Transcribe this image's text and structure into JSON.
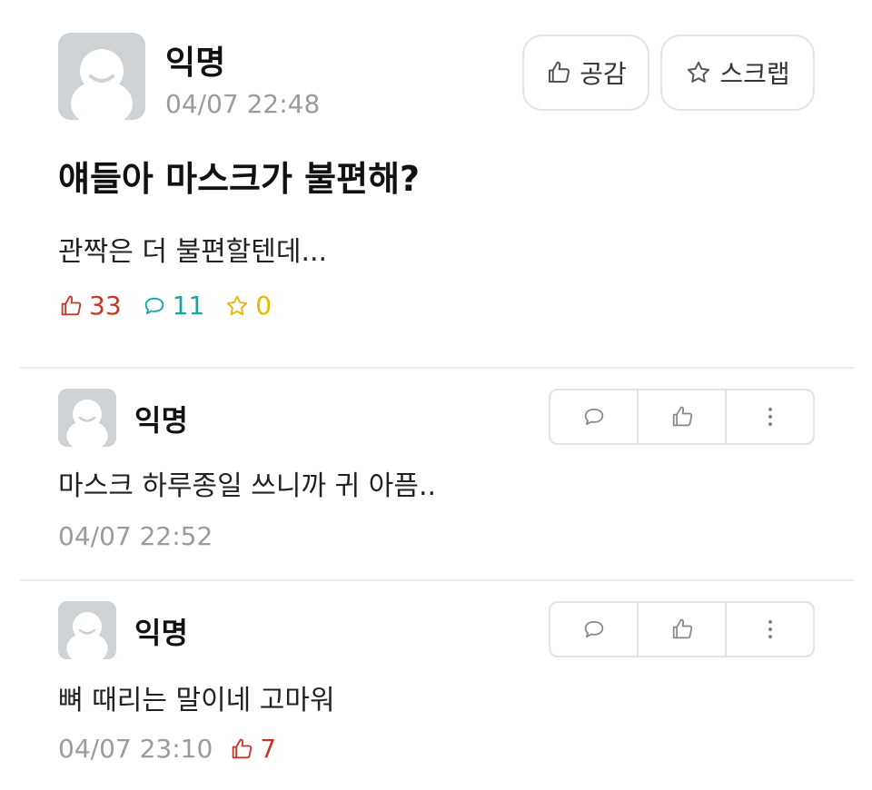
{
  "post": {
    "author": "익명",
    "time": "04/07 22:48",
    "like_button": "공감",
    "scrap_button": "스크랩",
    "title": "얘들아 마스크가 불편해?",
    "body": "관짝은 더 불편할텐데...",
    "stats": {
      "likes": "33",
      "comments": "11",
      "scraps": "0"
    }
  },
  "comments": [
    {
      "author": "익명",
      "text": "마스크 하루종일 쓰니까 귀 아픔..",
      "time": "04/07 22:52"
    },
    {
      "author": "익명",
      "text": "뼈 때리는 말이네 고마워",
      "time": "04/07 23:10",
      "likes": "7"
    }
  ],
  "colors": {
    "like": "#c0392b",
    "comment": "#1aa3a3",
    "scrap": "#e6b800",
    "muted": "#9b9b9b"
  },
  "icons": [
    "avatar-placeholder",
    "thumbs-up-icon",
    "star-icon",
    "speech-bubble-icon",
    "more-vertical-icon"
  ]
}
